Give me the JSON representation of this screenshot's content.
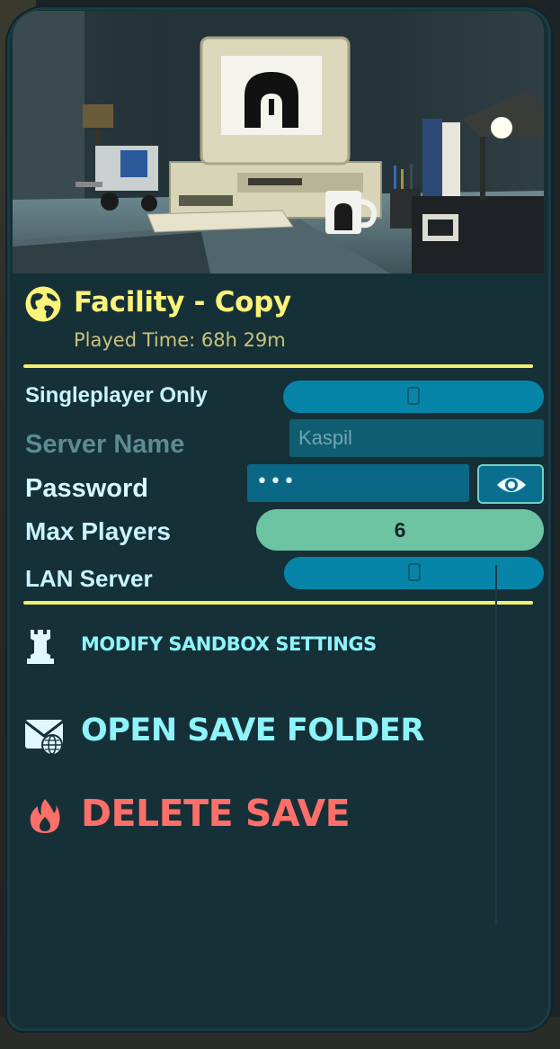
{
  "save": {
    "title": "Facility - Copy",
    "played_time": "Played Time: 68h 29m"
  },
  "settings": {
    "singleplayer_label": "Singleplayer Only",
    "singleplayer_on": false,
    "server_name_label": "Server Name",
    "server_name_value": "Kaspil",
    "password_label": "Password",
    "password_value": "•••",
    "max_players_label": "Max Players",
    "max_players_value": "6",
    "lan_label": "LAN Server",
    "lan_on": false
  },
  "actions": {
    "modify_sandbox": "MODIFY SANDBOX SETTINGS",
    "open_save_folder": "OPEN SAVE FOLDER",
    "delete_save": "DELETE SAVE"
  },
  "icons": {
    "world": "globe-icon",
    "sandbox": "rook-icon",
    "folder": "mail-globe-icon",
    "delete": "flame-icon",
    "reveal": "eye-icon"
  },
  "colors": {
    "panel": "#163038",
    "title": "#fbf27a",
    "accent_line": "#f3ee6f",
    "label": "#c8f4ff",
    "action": "#8ef4fb",
    "delete": "#ff6f6a",
    "toggle": "#0785a8",
    "max_players_field": "#6cc4a3"
  }
}
